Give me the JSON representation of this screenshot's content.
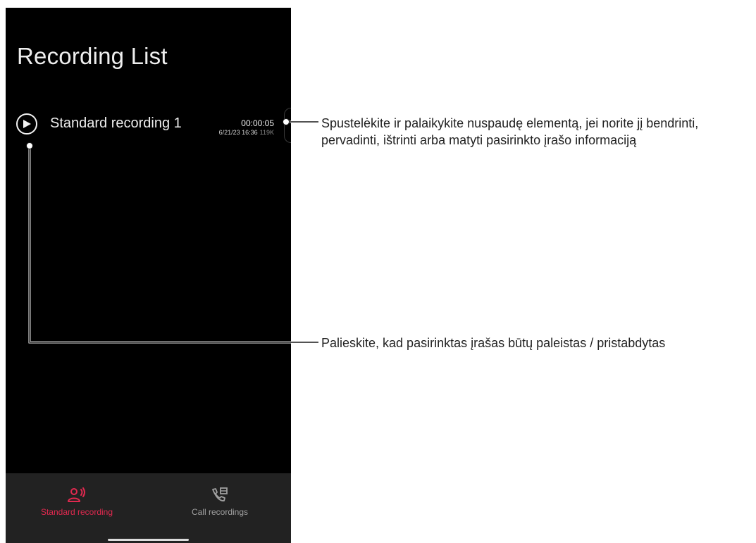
{
  "screen": {
    "title": "Recording List"
  },
  "recording": {
    "name": "Standard recording 1",
    "duration": "00:00:05",
    "date": "6/21/23 16:36",
    "size": "119K"
  },
  "bottom_nav": {
    "items": [
      {
        "label": "Standard recording",
        "icon": "standard-recording-icon",
        "active": true
      },
      {
        "label": "Call recordings",
        "icon": "call-recordings-icon",
        "active": false
      }
    ]
  },
  "callouts": {
    "long_press": "Spustelėkite ir palaikykite nuspaudę elementą, jei norite jį bendrinti, pervadinti, ištrinti arba matyti pasirinkto įrašo informaciją",
    "play_pause": "Palieskite, kad pasirinktas įrašas būtų paleistas / pristabdytas"
  },
  "colors": {
    "screen_background": "#000000",
    "nav_background": "#222222",
    "accent": "#e0294f",
    "inactive": "#a0a0a0",
    "callout_text": "#222222"
  }
}
